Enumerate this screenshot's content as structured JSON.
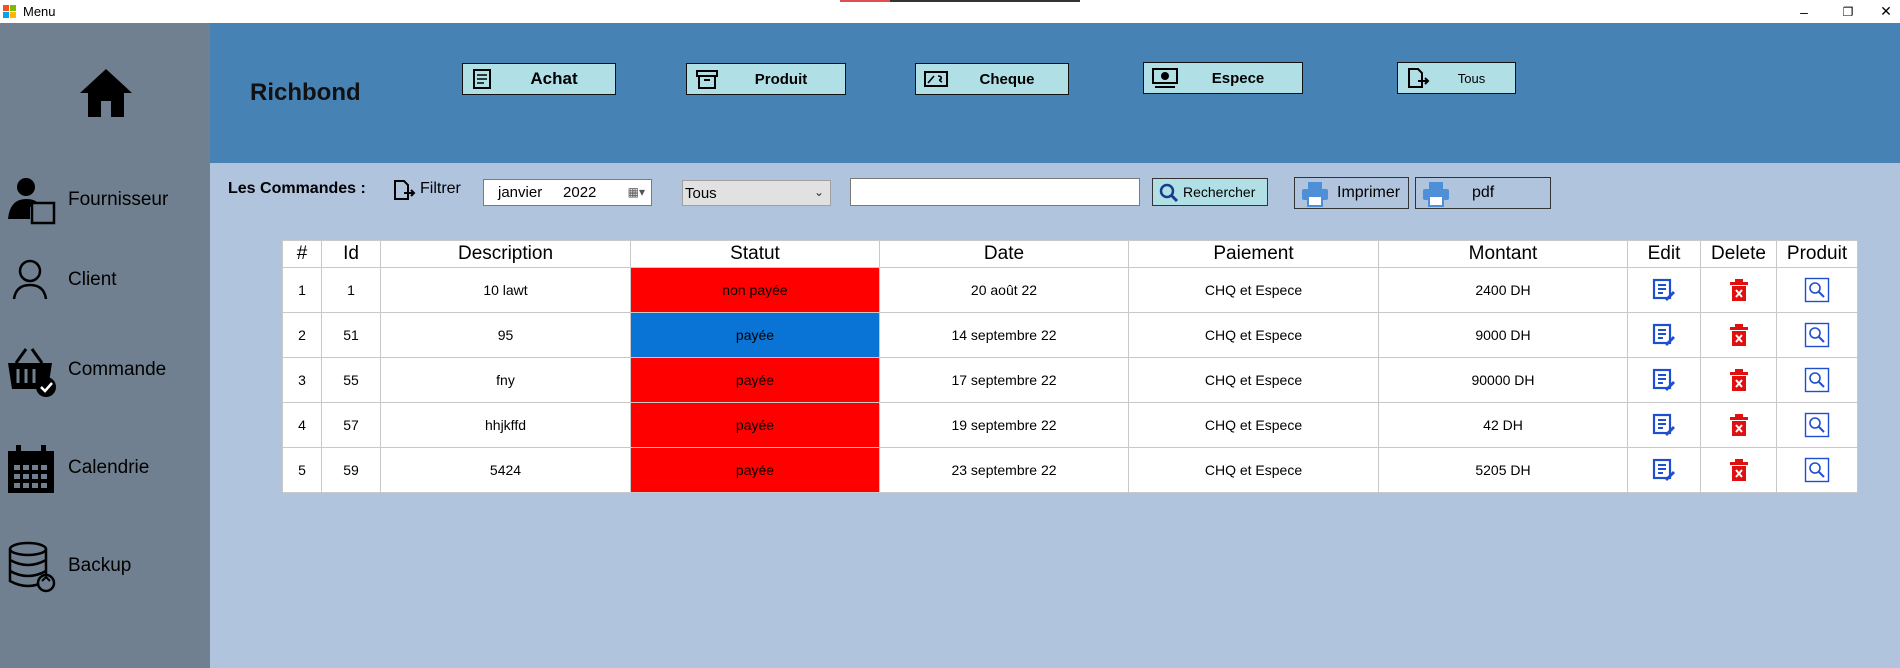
{
  "window": {
    "title": "Menu",
    "controls": {
      "minimize": "–",
      "restore": "❐",
      "close": "✕"
    }
  },
  "sidebar": {
    "items": [
      {
        "label": "Fournisseur",
        "icon": "supplier-icon"
      },
      {
        "label": "Client",
        "icon": "user-icon"
      },
      {
        "label": "Commande",
        "icon": "basket-check-icon"
      },
      {
        "label": "Calendrie",
        "icon": "calendar-icon"
      },
      {
        "label": "Backup",
        "icon": "database-sync-icon"
      }
    ]
  },
  "header": {
    "brand": "Richbond",
    "buttons": [
      {
        "label": "Achat",
        "icon": "receipt-icon"
      },
      {
        "label": "Produit",
        "icon": "archive-box-icon"
      },
      {
        "label": "Cheque",
        "icon": "cheque-icon"
      },
      {
        "label": "Espece",
        "icon": "cash-icon"
      },
      {
        "label": "Tous",
        "icon": "document-arrow-icon"
      }
    ]
  },
  "toolbar": {
    "label": "Les Commandes :",
    "filter_label": "Filtrer",
    "date_value": "janvier     2022",
    "status_select": "Tous",
    "search_value": "",
    "search_button": "Rechercher",
    "print_button": "Imprimer",
    "pdf_button": "pdf"
  },
  "table": {
    "columns": [
      "#",
      "Id",
      "Description",
      "Statut",
      "Date",
      "Paiement",
      "Montant",
      "Edit",
      "Delete",
      "Produit"
    ],
    "rows": [
      {
        "n": "1",
        "id": "1",
        "description": "10 lawt",
        "statut": "non payée",
        "statut_color": "#ff0000",
        "date": "20 août 22",
        "paiement": "CHQ et Espece",
        "montant": "2400 DH"
      },
      {
        "n": "2",
        "id": "51",
        "description": "95",
        "statut": "payée",
        "statut_color": "#0a74d6",
        "date": "14 septembre 22",
        "paiement": "CHQ et Espece",
        "montant": "9000 DH"
      },
      {
        "n": "3",
        "id": "55",
        "description": "fny",
        "statut": "payée",
        "statut_color": "#ff0000",
        "date": "17 septembre 22",
        "paiement": "CHQ et Espece",
        "montant": "90000 DH"
      },
      {
        "n": "4",
        "id": "57",
        "description": "hhjkffd",
        "statut": "payée",
        "statut_color": "#ff0000",
        "date": "19 septembre 22",
        "paiement": "CHQ et Espece",
        "montant": "42 DH"
      },
      {
        "n": "5",
        "id": "59",
        "description": "5424",
        "statut": "payée",
        "statut_color": "#ff0000",
        "date": "23 septembre 22",
        "paiement": "CHQ et Espece",
        "montant": "5205 DH"
      }
    ]
  },
  "colors": {
    "sidebar": "#708090",
    "header": "#4682b4",
    "main": "#b0c4de",
    "button": "#b0e0e6",
    "edit_icon": "#1f4fd1",
    "delete_icon": "#e01010"
  }
}
